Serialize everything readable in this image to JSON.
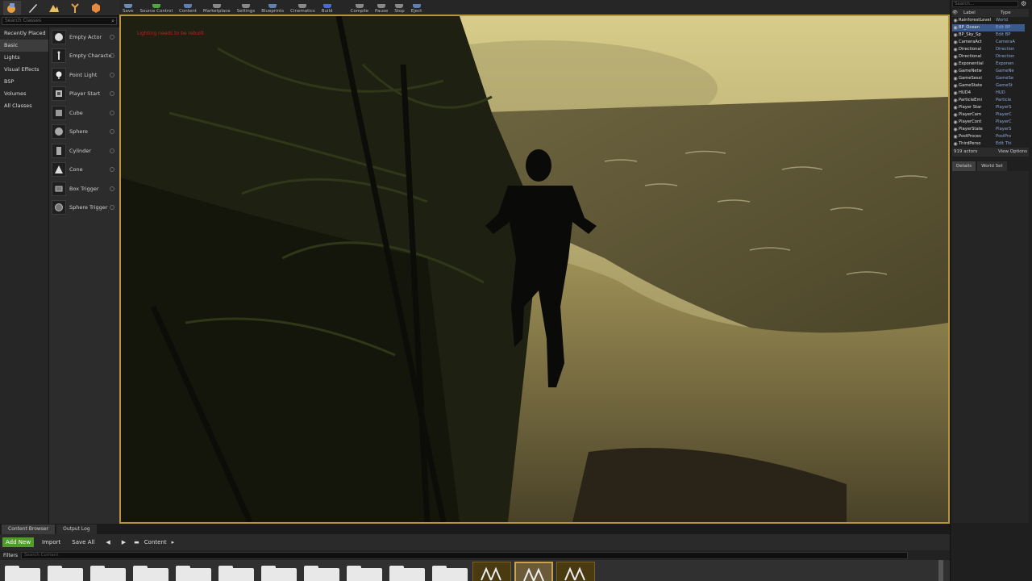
{
  "modes_bar": {
    "icons": [
      "place-mode-icon",
      "paint-mode-icon",
      "landscape-mode-icon",
      "foliage-mode-icon",
      "geometry-mode-icon"
    ]
  },
  "placement": {
    "search_placeholder": "Search Classes",
    "categories": [
      "Recently Placed",
      "Basic",
      "Lights",
      "Visual Effects",
      "BSP",
      "Volumes",
      "All Classes"
    ],
    "active_category": "Basic",
    "items": [
      {
        "label": "Empty Actor",
        "icon": "sphere-icon"
      },
      {
        "label": "Empty Characte",
        "icon": "character-icon"
      },
      {
        "label": "Point Light",
        "icon": "light-bulb-icon"
      },
      {
        "label": "Player Start",
        "icon": "player-start-icon"
      },
      {
        "label": "Cube",
        "icon": "cube-icon"
      },
      {
        "label": "Sphere",
        "icon": "sphere-icon"
      },
      {
        "label": "Cylinder",
        "icon": "cylinder-icon"
      },
      {
        "label": "Cone",
        "icon": "cone-icon"
      },
      {
        "label": "Box Trigger",
        "icon": "box-trigger-icon"
      },
      {
        "label": "Sphere Trigger",
        "icon": "sphere-trigger-icon"
      }
    ]
  },
  "toolbar": {
    "buttons": [
      {
        "label": "Save",
        "color": "#6a8ab8"
      },
      {
        "label": "Source Control",
        "color": "#4caa3c"
      },
      {
        "label": "Content",
        "color": "#5f7fb0"
      },
      {
        "label": "Marketplace",
        "color": "#888888"
      },
      {
        "label": "Settings",
        "color": "#888888"
      },
      {
        "label": "Blueprints",
        "color": "#5f7fb0"
      },
      {
        "label": "Cinematics",
        "color": "#888888"
      },
      {
        "label": "Build",
        "color": "#4a6ad8"
      },
      {
        "label": "Compile",
        "color": "#888888"
      },
      {
        "label": "Pause",
        "color": "#888888"
      },
      {
        "label": "Stop",
        "color": "#888888"
      },
      {
        "label": "Eject",
        "color": "#5f7fb0"
      }
    ]
  },
  "viewport": {
    "stat_text": "Lighting needs to be rebuilt",
    "border_color": "#b8953a"
  },
  "outliner": {
    "search_placeholder": "Search...",
    "col_label": "Label",
    "col_type": "Type",
    "rows": [
      {
        "name": "RainforestLevel",
        "type": "World",
        "selected": false
      },
      {
        "name": "BP_Ocean",
        "type": "Edit BP",
        "selected": true
      },
      {
        "name": "BP_Sky_Sp",
        "type": "Edit BP",
        "selected": false
      },
      {
        "name": "CameraAct",
        "type": "CameraA",
        "selected": false
      },
      {
        "name": "Directional",
        "type": "Direction",
        "selected": false
      },
      {
        "name": "Directional",
        "type": "Direction",
        "selected": false
      },
      {
        "name": "Exponential",
        "type": "Exponen",
        "selected": false
      },
      {
        "name": "GameNetw",
        "type": "GameNe",
        "selected": false
      },
      {
        "name": "GameSessi",
        "type": "GameSe",
        "selected": false
      },
      {
        "name": "GameState",
        "type": "GameSt",
        "selected": false
      },
      {
        "name": "HUD4",
        "type": "HUD",
        "selected": false
      },
      {
        "name": "ParticleEmi",
        "type": "Particle",
        "selected": false
      },
      {
        "name": "Player Star",
        "type": "PlayerS",
        "selected": false
      },
      {
        "name": "PlayerCam",
        "type": "PlayerC",
        "selected": false
      },
      {
        "name": "PlayerCont",
        "type": "PlayerC",
        "selected": false
      },
      {
        "name": "PlayerState",
        "type": "PlayerS",
        "selected": false
      },
      {
        "name": "PostProces",
        "type": "PostPro",
        "selected": false
      },
      {
        "name": "ThirdPerso",
        "type": "Edit Thi",
        "selected": false
      }
    ],
    "actor_count": "919 actors",
    "view_options": "View Options"
  },
  "details": {
    "tabs": [
      "Details",
      "World Set"
    ]
  },
  "content_browser": {
    "tabs": [
      "Content Browser",
      "Output Log"
    ],
    "add_new": "Add New",
    "import": "Import",
    "save_all": "Save All",
    "path": "Content",
    "filters": "Filters",
    "search_placeholder": "Search Content",
    "folder_count": 11,
    "asset_count": 3
  }
}
